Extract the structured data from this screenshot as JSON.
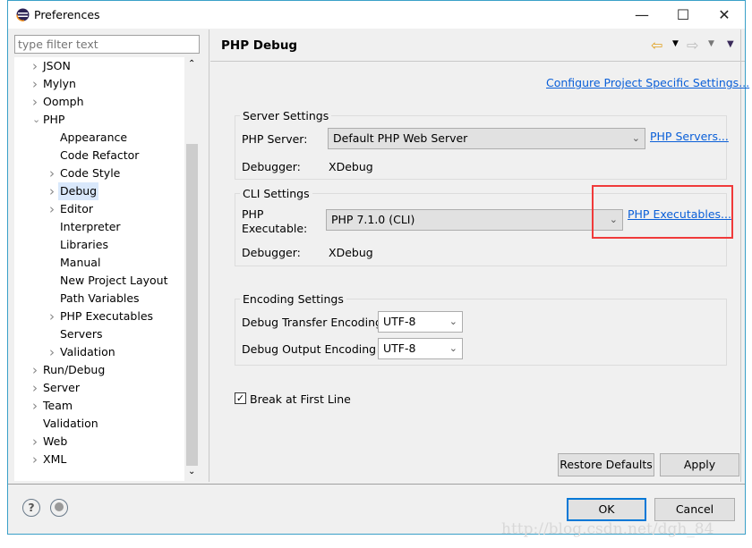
{
  "window": {
    "title": "Preferences",
    "minimize": "—",
    "maximize": "☐",
    "close": "✕"
  },
  "filter": {
    "placeholder": "type filter text"
  },
  "tree": [
    {
      "label": "JSON",
      "level": 0,
      "arrow": "right"
    },
    {
      "label": "Mylyn",
      "level": 0,
      "arrow": "right"
    },
    {
      "label": "Oomph",
      "level": 0,
      "arrow": "right"
    },
    {
      "label": "PHP",
      "level": 0,
      "arrow": "down"
    },
    {
      "label": "Appearance",
      "level": 1,
      "arrow": "none"
    },
    {
      "label": "Code Refactor",
      "level": 1,
      "arrow": "none"
    },
    {
      "label": "Code Style",
      "level": 1,
      "arrow": "right"
    },
    {
      "label": "Debug",
      "level": 1,
      "arrow": "right",
      "selected": true
    },
    {
      "label": "Editor",
      "level": 1,
      "arrow": "right"
    },
    {
      "label": "Interpreter",
      "level": 1,
      "arrow": "none"
    },
    {
      "label": "Libraries",
      "level": 1,
      "arrow": "none"
    },
    {
      "label": "Manual",
      "level": 1,
      "arrow": "none"
    },
    {
      "label": "New Project Layout",
      "level": 1,
      "arrow": "none"
    },
    {
      "label": "Path Variables",
      "level": 1,
      "arrow": "none"
    },
    {
      "label": "PHP Executables",
      "level": 1,
      "arrow": "right"
    },
    {
      "label": "Servers",
      "level": 1,
      "arrow": "none"
    },
    {
      "label": "Validation",
      "level": 1,
      "arrow": "right"
    },
    {
      "label": "Run/Debug",
      "level": 0,
      "arrow": "right"
    },
    {
      "label": "Server",
      "level": 0,
      "arrow": "right"
    },
    {
      "label": "Team",
      "level": 0,
      "arrow": "right"
    },
    {
      "label": "Validation",
      "level": 0,
      "arrow": "none"
    },
    {
      "label": "Web",
      "level": 0,
      "arrow": "right"
    },
    {
      "label": "XML",
      "level": 0,
      "arrow": "right"
    }
  ],
  "page": {
    "title": "PHP Debug",
    "configure_link": "Configure Project Specific Settings...",
    "server": {
      "legend": "Server Settings",
      "php_server_label": "PHP Server:",
      "php_server_value": "Default PHP Web Server",
      "servers_link": "PHP Servers...",
      "debugger_label": "Debugger:",
      "debugger_value": "XDebug"
    },
    "cli": {
      "legend": "CLI Settings",
      "exe_label_1": "PHP",
      "exe_label_2": "Executable:",
      "exe_value": "PHP 7.1.0 (CLI)",
      "exe_link": "PHP Executables...",
      "debugger_label": "Debugger:",
      "debugger_value": "XDebug"
    },
    "encoding": {
      "legend": "Encoding Settings",
      "transfer_label": "Debug Transfer Encoding",
      "transfer_value": "UTF-8",
      "output_label": "Debug Output Encoding",
      "output_value": "UTF-8"
    },
    "break_first_line": {
      "label": "Break at First Line",
      "checked": true
    },
    "restore_defaults": "Restore Defaults",
    "apply": "Apply"
  },
  "footer": {
    "ok": "OK",
    "cancel": "Cancel",
    "help": "?"
  },
  "highlight_color": "#f03a3a",
  "watermark": "http://blog.csdn.net/dgh_84"
}
